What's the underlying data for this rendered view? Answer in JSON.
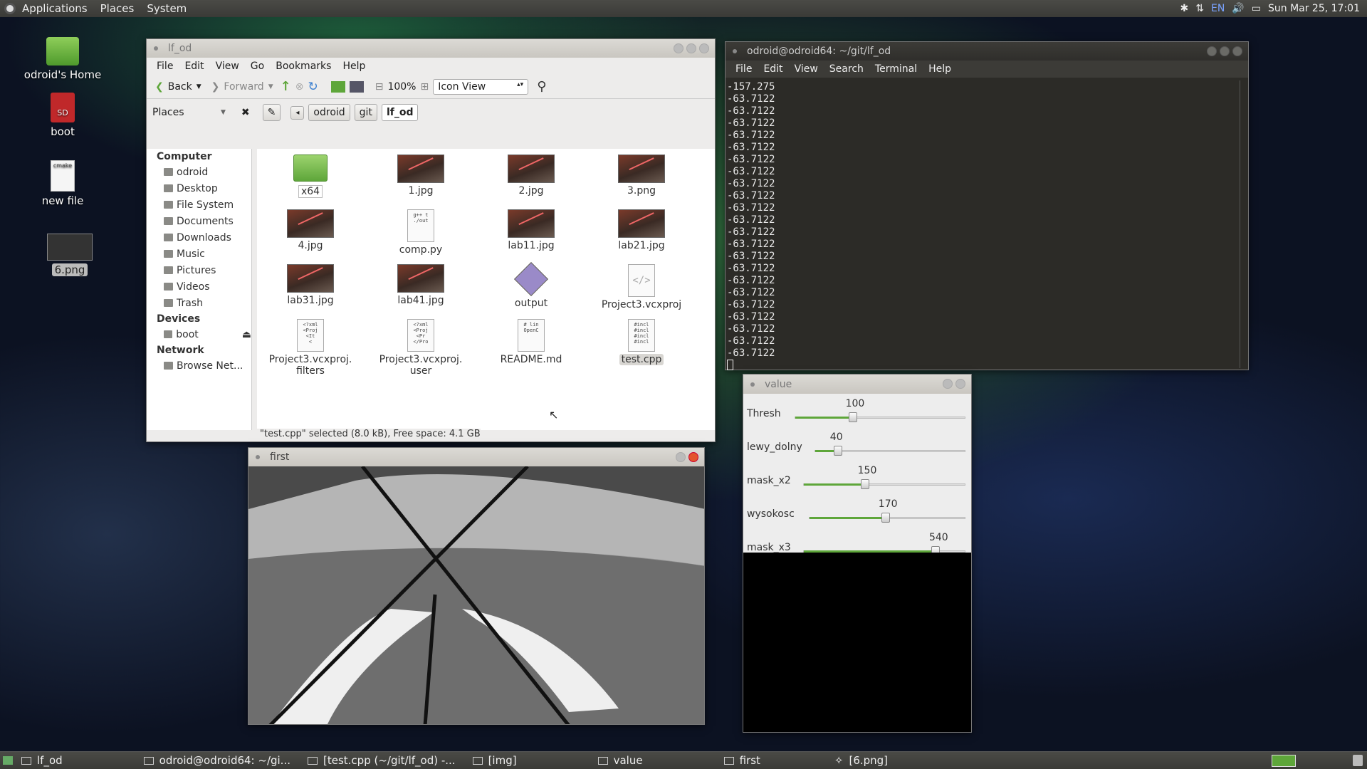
{
  "top_panel": {
    "menus": [
      "Applications",
      "Places",
      "System"
    ],
    "indicators": [
      "bluetooth-icon",
      "network-icon",
      "EN",
      "volume-icon",
      "battery-icon"
    ],
    "clock": "Sun Mar 25, 17:01"
  },
  "desktop_icons": [
    {
      "label": "odroid's Home",
      "icon": "home-folder-icon"
    },
    {
      "label": "boot",
      "icon": "sd-card-icon"
    },
    {
      "label": "new file",
      "icon": "cmake-file-icon"
    },
    {
      "label": "6.png",
      "icon": "image-icon"
    }
  ],
  "file_manager": {
    "title": "lf_od",
    "menu": [
      "File",
      "Edit",
      "View",
      "Go",
      "Bookmarks",
      "Help"
    ],
    "toolbar": {
      "back": "Back",
      "forward": "Forward",
      "zoom": "100%",
      "view_mode": "Icon View"
    },
    "places_label": "Places",
    "breadcrumbs": [
      "odroid",
      "git",
      "lf_od"
    ],
    "sidebar": {
      "computer_header": "Computer",
      "computer_items": [
        "odroid",
        "Desktop",
        "File System",
        "Documents",
        "Downloads",
        "Music",
        "Pictures",
        "Videos",
        "Trash"
      ],
      "devices_header": "Devices",
      "devices_items": [
        "boot"
      ],
      "network_header": "Network",
      "network_items": [
        "Browse Net..."
      ]
    },
    "files": [
      {
        "name": "x64",
        "type": "folder"
      },
      {
        "name": "1.jpg",
        "type": "image"
      },
      {
        "name": "2.jpg",
        "type": "image"
      },
      {
        "name": "3.png",
        "type": "image"
      },
      {
        "name": "4.jpg",
        "type": "image"
      },
      {
        "name": "comp.py",
        "type": "text",
        "preview": "g++ t\n./out"
      },
      {
        "name": "lab11.jpg",
        "type": "image"
      },
      {
        "name": "lab21.jpg",
        "type": "image"
      },
      {
        "name": "lab31.jpg",
        "type": "image"
      },
      {
        "name": "lab41.jpg",
        "type": "image"
      },
      {
        "name": "output",
        "type": "executable"
      },
      {
        "name": "Project3.vcxproj",
        "type": "xml"
      },
      {
        "name": "Project3.vcxproj.\nfilters",
        "type": "text",
        "preview": "<?xml\n<Proj\n<It\n<"
      },
      {
        "name": "Project3.vcxproj.\nuser",
        "type": "text",
        "preview": "<?xml\n<Proj\n<Pr\n</Pro"
      },
      {
        "name": "README.md",
        "type": "text",
        "preview": "# lin\nOpenC"
      },
      {
        "name": "test.cpp",
        "type": "text",
        "preview": "#incl\n#incl\n#incl\n#incl",
        "selected": true
      }
    ],
    "status": "\"test.cpp\" selected (8.0 kB), Free space: 4.1 GB"
  },
  "terminal": {
    "title": "odroid@odroid64: ~/git/lf_od",
    "menu": [
      "File",
      "Edit",
      "View",
      "Search",
      "Terminal",
      "Help"
    ],
    "lines": [
      "-157.275",
      "-63.7122",
      "-63.7122",
      "-63.7122",
      "-63.7122",
      "-63.7122",
      "-63.7122",
      "-63.7122",
      "-63.7122",
      "-63.7122",
      "-63.7122",
      "-63.7122",
      "-63.7122",
      "-63.7122",
      "-63.7122",
      "-63.7122",
      "-63.7122",
      "-63.7122",
      "-63.7122",
      "-63.7122",
      "-63.7122",
      "-63.7122",
      "-63.7122"
    ]
  },
  "value_window": {
    "title": "value",
    "trackbars": [
      {
        "name": "Thresh",
        "value": "100",
        "fraction": 0.34
      },
      {
        "name": "lewy_dolny",
        "value": "40",
        "fraction": 0.15
      },
      {
        "name": "mask_x2",
        "value": "150",
        "fraction": 0.38
      },
      {
        "name": "wysokosc",
        "value": "170",
        "fraction": 0.49
      },
      {
        "name": "mask_x3",
        "value": "540",
        "fraction": 0.82
      }
    ]
  },
  "image_window": {
    "title": "first"
  },
  "taskbar": {
    "items": [
      "lf_od",
      "odroid@odroid64: ~/gi...",
      "[test.cpp (~/git/lf_od) -...",
      "[img]",
      "value",
      "first",
      "[6.png]"
    ]
  },
  "colors": {
    "accent_green": "#5ea63a",
    "panel": "#3c3b37",
    "terminal_bg": "#2c2b27",
    "close_red": "#e3542d"
  }
}
